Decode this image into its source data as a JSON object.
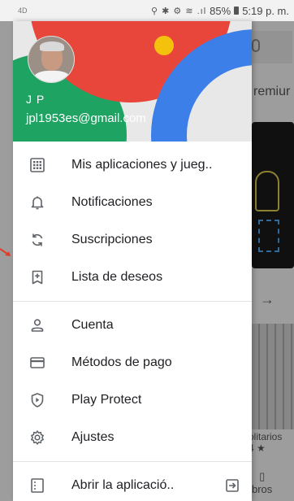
{
  "status_bar": {
    "left": "4D",
    "battery": "85%",
    "time": "5:19 p. m."
  },
  "background": {
    "premium_fragment": "remiur",
    "solitarios_fragment": "olitarios",
    "rating_fragment": "4 ★",
    "books_fragment": "bros"
  },
  "user": {
    "name": "J P",
    "email": "jpl1953es@gmail.com"
  },
  "menu": {
    "group1": [
      {
        "label": "Mis aplicaciones y jueg..",
        "icon": "apps-grid-icon"
      },
      {
        "label": "Notificaciones",
        "icon": "bell-icon"
      },
      {
        "label": "Suscripciones",
        "icon": "refresh-icon"
      },
      {
        "label": "Lista de deseos",
        "icon": "bookmark-plus-icon"
      }
    ],
    "group2": [
      {
        "label": "Cuenta",
        "icon": "person-icon"
      },
      {
        "label": "Métodos de pago",
        "icon": "credit-card-icon"
      },
      {
        "label": "Play Protect",
        "icon": "shield-icon"
      },
      {
        "label": "Ajustes",
        "icon": "gear-icon"
      }
    ],
    "group3": [
      {
        "label": "Abrir la aplicació..",
        "icon": "open-app-icon"
      }
    ]
  }
}
